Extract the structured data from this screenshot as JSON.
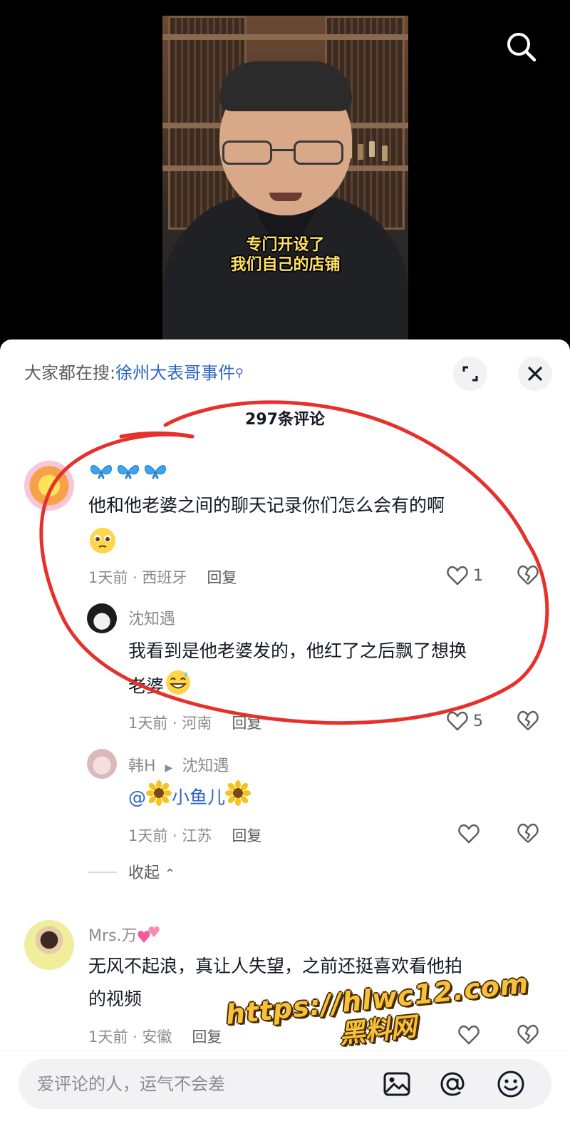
{
  "video": {
    "subtitle_line1": "专门开设了",
    "subtitle_line2": "我们自己的店铺",
    "search_icon": "search-icon"
  },
  "sheet": {
    "hot_search_prefix": "大家都在搜:",
    "hot_search_term": "徐州大表哥事件",
    "comment_count": "297条评论",
    "expand_icon": "expand-icon",
    "close_icon": "close-icon"
  },
  "comments": [
    {
      "username": "🦋🦋🦋",
      "text": "他和他老婆之间的聊天记录你们怎么会有的啊",
      "time_location": "1天前 · 西班牙",
      "reply_label": "回复",
      "likes": "1"
    },
    {
      "username": "沈知遇",
      "text_line1": "我看到是他老婆发的，他红了之后飘了想换",
      "text_line2": "老婆",
      "time_location": "1天前 · 河南",
      "reply_label": "回复",
      "likes": "5"
    },
    {
      "username": "韩H",
      "reply_to": "沈知遇",
      "text_mention": "@",
      "text_name": "小鱼儿",
      "time_location": "1天前 · 江苏",
      "reply_label": "回复",
      "likes": ""
    },
    {
      "username": "Mrs.万",
      "text_line1": "无风不起浪，真让人失望，之前还挺喜欢看他拍",
      "text_line2": "的视频",
      "time_location": "1天前 · 安徽",
      "reply_label": "回复",
      "likes": ""
    }
  ],
  "collapse_label": "收起",
  "input": {
    "placeholder": "爱评论的人，运气不会差",
    "image_icon": "image-icon",
    "at_icon": "at-icon",
    "emoji_icon": "emoji-icon"
  },
  "watermark": {
    "line1": "https://hlwc12.com",
    "line2": "黑料网"
  },
  "colors": {
    "link": "#2b63c4",
    "annotation": "#e8302a",
    "watermark": "#f7c23a"
  }
}
